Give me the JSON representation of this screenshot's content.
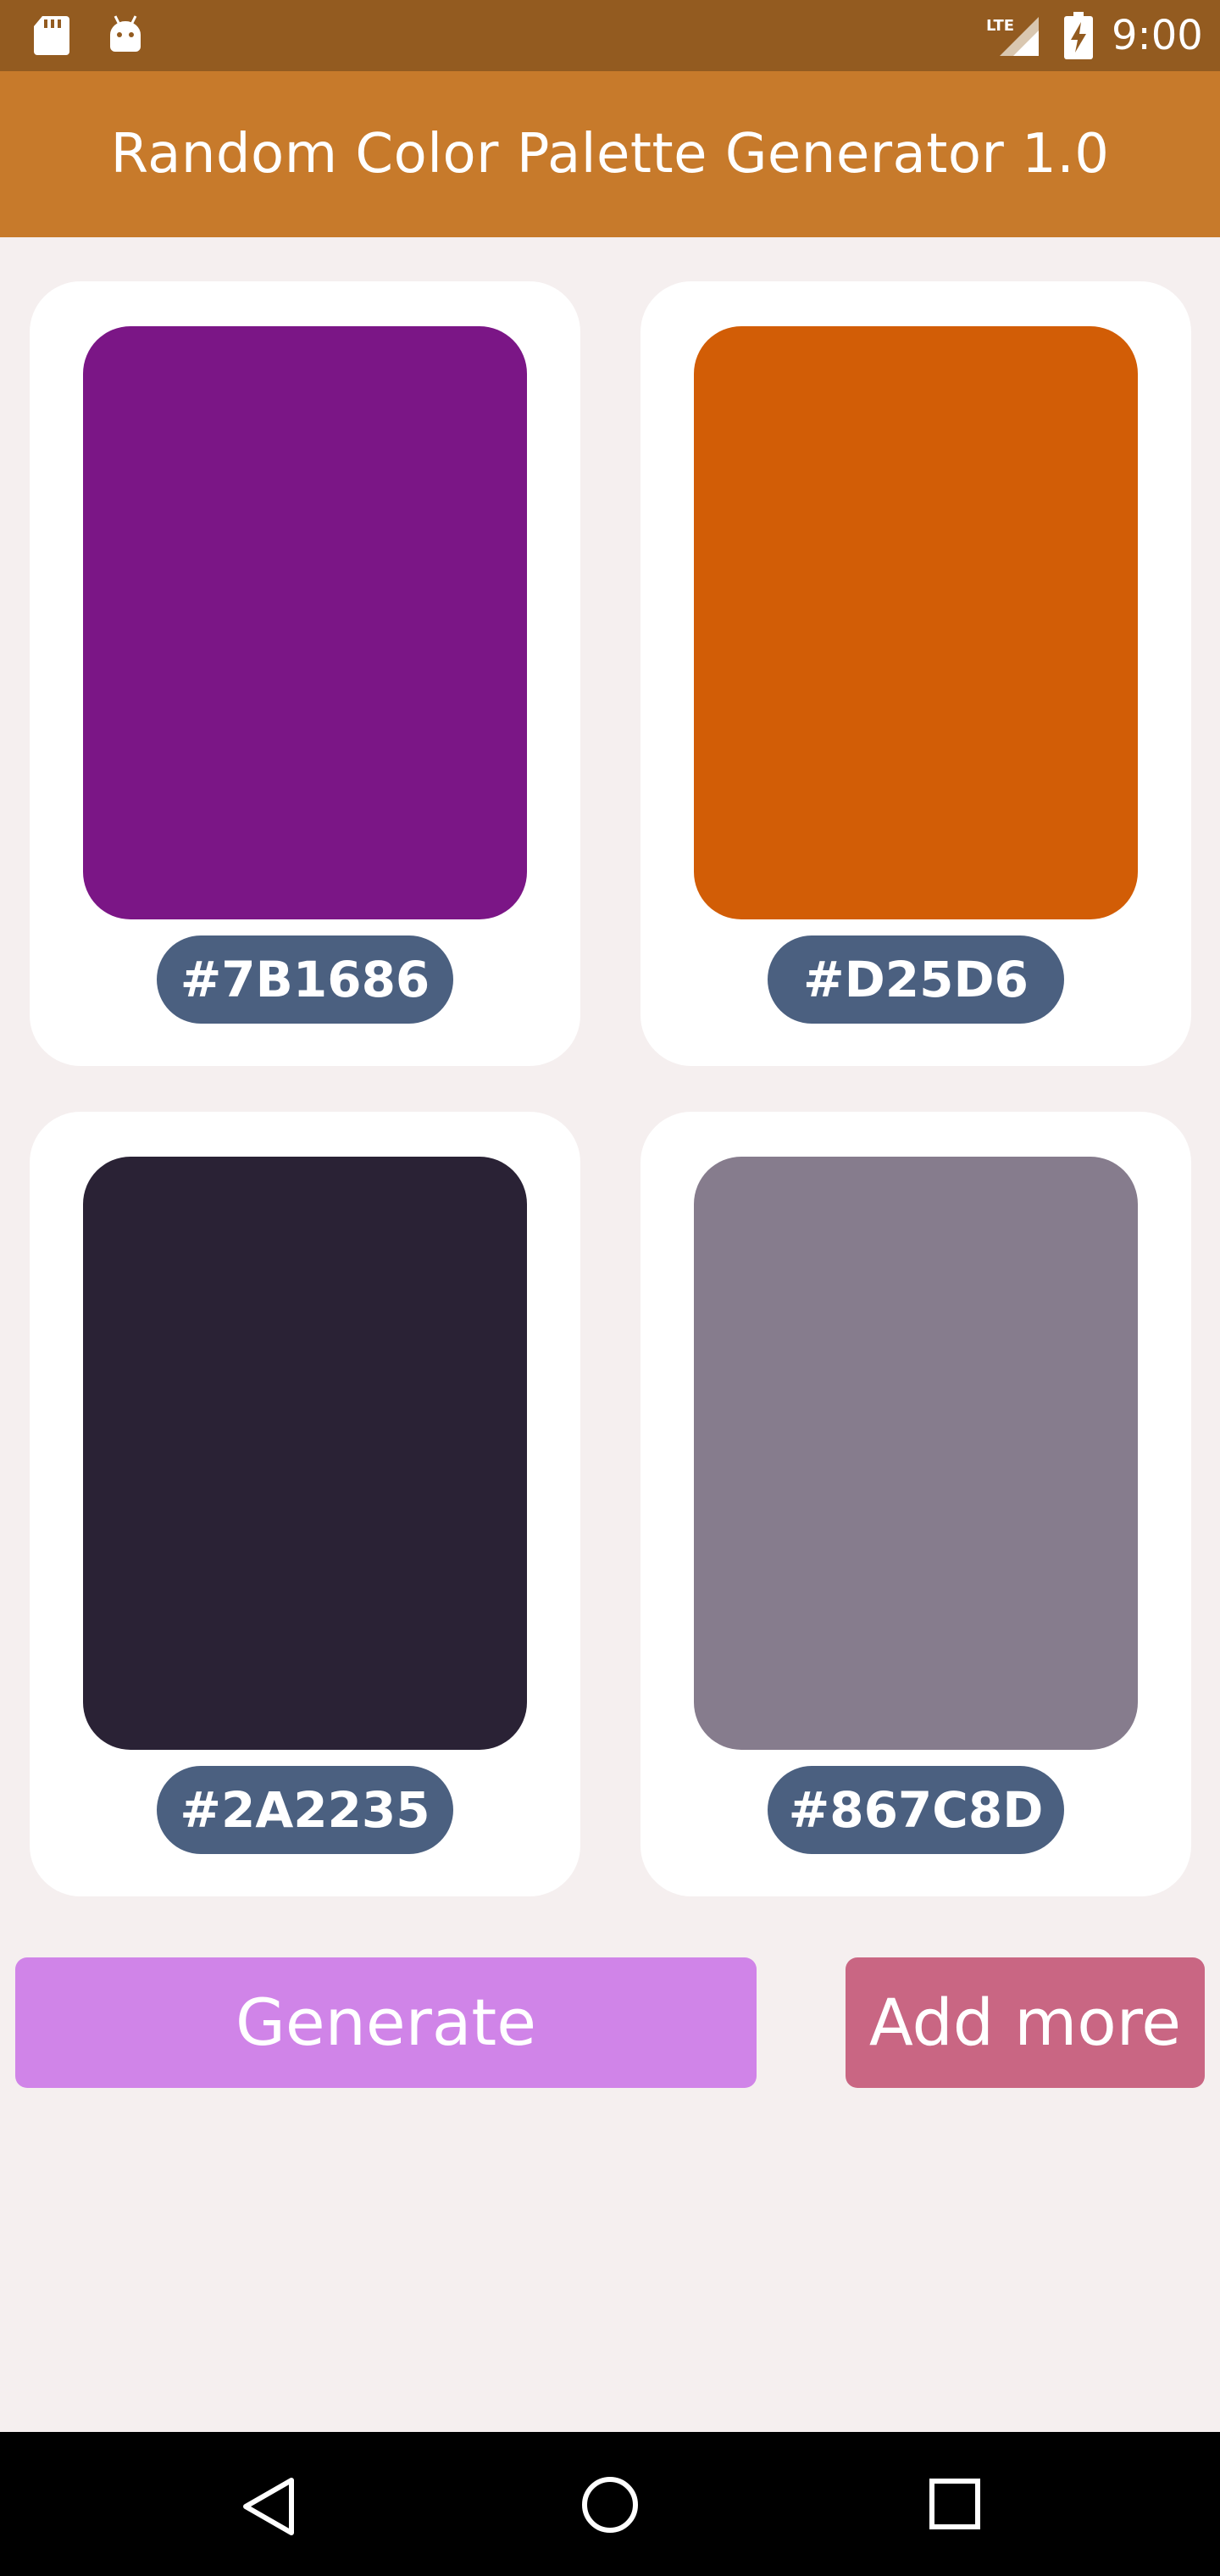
{
  "status_bar": {
    "time": "9:00",
    "icons": [
      "sd-card-icon",
      "android-icon",
      "lte-signal-icon",
      "battery-charging-icon"
    ]
  },
  "app_bar": {
    "title": "Random Color Palette Generator 1.0",
    "color": "#c77a2b"
  },
  "palette": [
    {
      "hex": "#7B1686",
      "color": "#7B1686"
    },
    {
      "hex": "#D25D6",
      "color": "#D25D06"
    },
    {
      "hex": "#2A2235",
      "color": "#2A2235"
    },
    {
      "hex": "#867C8D",
      "color": "#867C8D"
    }
  ],
  "actions": {
    "generate_label": "Generate",
    "generate_color": "#d084e8",
    "add_more_label": "Add more",
    "add_more_color": "#c96683"
  },
  "nav_bar": {
    "icons": [
      "back-icon",
      "home-icon",
      "recents-icon"
    ]
  }
}
